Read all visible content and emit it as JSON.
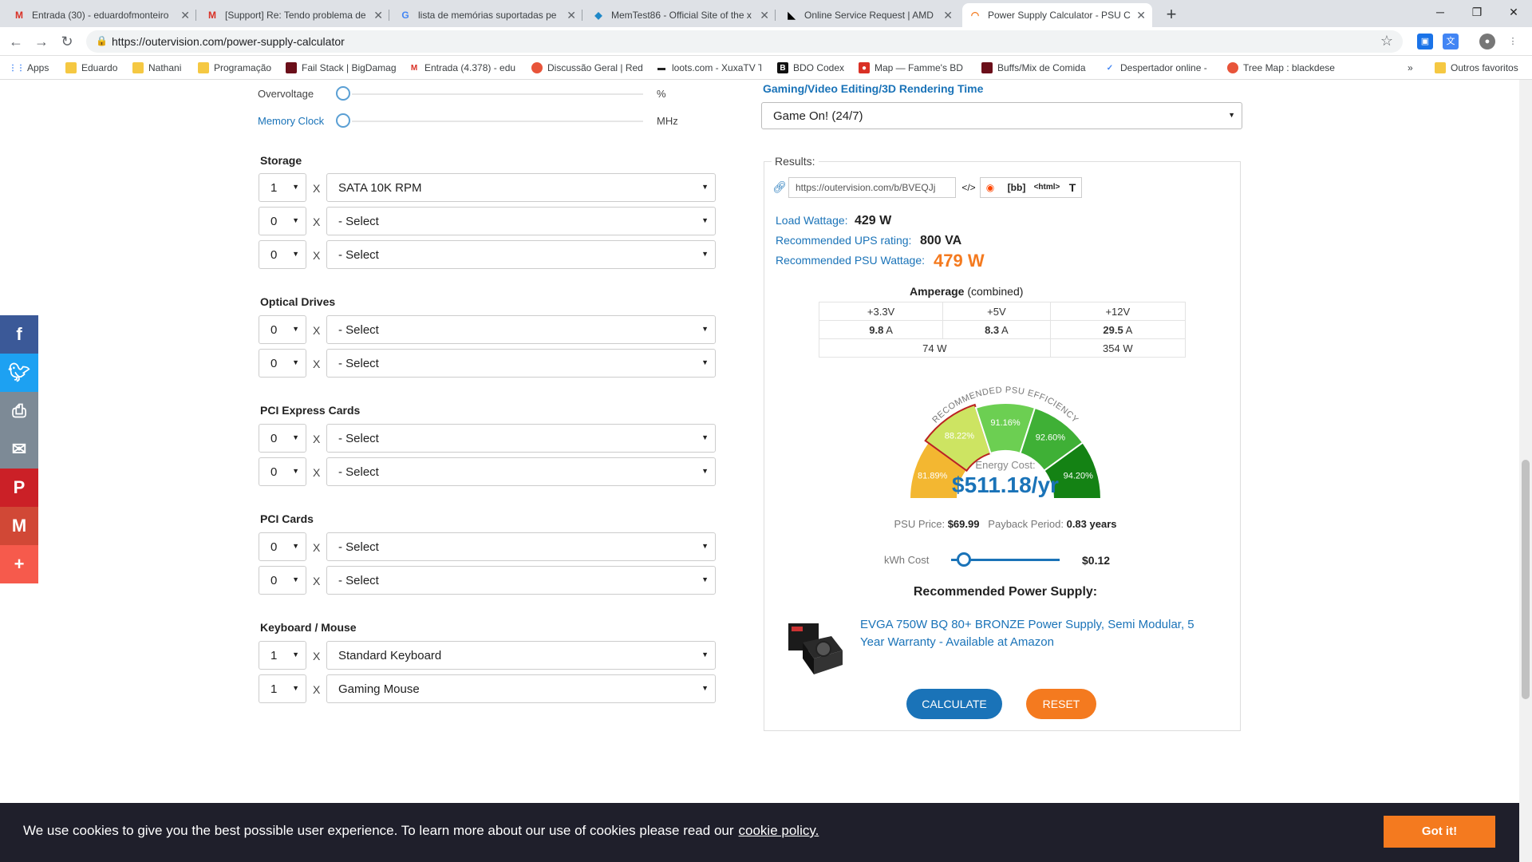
{
  "tabs": [
    {
      "title": "Entrada (30) - eduardofmonteiro",
      "icon": "gmail-icon"
    },
    {
      "title": "[Support] Re: Tendo problema de",
      "icon": "gmail-icon"
    },
    {
      "title": "lista de memórias suportadas pe",
      "icon": "google-icon"
    },
    {
      "title": "MemTest86 - Official Site of the x",
      "icon": "memtest-icon"
    },
    {
      "title": "Online Service Request | AMD",
      "icon": "amd-icon"
    },
    {
      "title": "Power Supply Calculator - PSU C",
      "icon": "outervision-icon"
    }
  ],
  "address": {
    "url": "https://outervision.com/power-supply-calculator"
  },
  "bookmarks": [
    {
      "label": "Apps"
    },
    {
      "label": "Eduardo"
    },
    {
      "label": "Nathani"
    },
    {
      "label": "Programação"
    },
    {
      "label": "Fail Stack | BigDamag"
    },
    {
      "label": "Entrada (4.378) - edu"
    },
    {
      "label": "Discussão Geral | Red"
    },
    {
      "label": "loots.com - XuxaTV T"
    },
    {
      "label": "BDO Codex"
    },
    {
      "label": "Map — Famme's BD"
    },
    {
      "label": "Buffs/Mix de Comida"
    },
    {
      "label": "Despertador online -"
    },
    {
      "label": "Tree Map : blackdese"
    },
    {
      "label": "»"
    },
    {
      "label": "Outros favoritos"
    }
  ],
  "overclock": {
    "overvoltage_label": "Overvoltage",
    "overvoltage_unit": "%",
    "memory_clock_label": "Memory Clock",
    "memory_clock_unit": "MHz"
  },
  "sections": {
    "storage": {
      "title": "Storage",
      "rows": [
        {
          "qty": "1",
          "value": "SATA 10K RPM"
        },
        {
          "qty": "0",
          "value": "- Select"
        },
        {
          "qty": "0",
          "value": "- Select"
        }
      ]
    },
    "optical": {
      "title": "Optical Drives",
      "rows": [
        {
          "qty": "0",
          "value": "- Select"
        },
        {
          "qty": "0",
          "value": "- Select"
        }
      ]
    },
    "pcie": {
      "title": "PCI Express Cards",
      "rows": [
        {
          "qty": "0",
          "value": "- Select"
        },
        {
          "qty": "0",
          "value": "- Select"
        }
      ]
    },
    "pci": {
      "title": "PCI Cards",
      "rows": [
        {
          "qty": "0",
          "value": "- Select"
        },
        {
          "qty": "0",
          "value": "- Select"
        }
      ]
    },
    "keyboard": {
      "title": "Keyboard / Mouse",
      "rows": [
        {
          "qty": "1",
          "value": "Standard Keyboard"
        },
        {
          "qty": "1",
          "value": "Gaming Mouse"
        }
      ]
    }
  },
  "x_sep": "X",
  "gaming_time": {
    "label": "Gaming/Video Editing/3D Rendering Time",
    "value": "Game On! (24/7)"
  },
  "results": {
    "legend": "Results:",
    "share_url": "https://outervision.com/b/BVEQJj",
    "share_buttons": [
      "</>",
      "[bb]",
      "<html>",
      "T"
    ],
    "load_wattage_label": "Load Wattage:",
    "load_wattage": "429 W",
    "ups_label": "Recommended UPS rating:",
    "ups": "800 VA",
    "psu_label": "Recommended PSU Wattage:",
    "psu": "479 W"
  },
  "amperage": {
    "title_bold": "Amperage",
    "title_rest": " (combined)",
    "rails": [
      "+3.3V",
      "+5V",
      "+12V"
    ],
    "amps": [
      "9.8",
      "8.3",
      "29.5"
    ],
    "amp_unit": "A",
    "watts": [
      "74 W",
      "354 W"
    ]
  },
  "efficiency": {
    "title": "RECOMMENDED PSU EFFICIENCY",
    "segments": [
      {
        "label": "81.89%",
        "color": "#f3b731"
      },
      {
        "label": "88.22%",
        "color": "#cde462"
      },
      {
        "label": "91.16%",
        "color": "#6ccf52"
      },
      {
        "label": "92.60%",
        "color": "#3fb036"
      },
      {
        "label": "94.20%",
        "color": "#148214"
      }
    ],
    "selected_index": 1,
    "energy_cost_label": "Energy Cost:",
    "energy_cost": "$511.18/yr"
  },
  "price": {
    "psu_price_label": "PSU Price:",
    "psu_price": "$69.99",
    "payback_label": "Payback Period:",
    "payback": "0.83 years"
  },
  "kwh": {
    "label": "kWh Cost",
    "value": "$0.12"
  },
  "recommendation": {
    "title": "Recommended Power Supply:",
    "product": "EVGA 750W BQ 80+ BRONZE Power Supply, Semi Modular, 5 Year Warranty - Available at Amazon"
  },
  "buttons": {
    "calculate": "CALCULATE",
    "reset": "RESET"
  },
  "social": [
    {
      "icon": "facebook-icon",
      "glyph": "f",
      "color": "#3b5998"
    },
    {
      "icon": "twitter-icon",
      "glyph": "t",
      "color": "#1da1f2"
    },
    {
      "icon": "print-icon",
      "glyph": "⎙",
      "color": "#7d8a96"
    },
    {
      "icon": "email-icon",
      "glyph": "✉",
      "color": "#7d8a96"
    },
    {
      "icon": "pinterest-icon",
      "glyph": "P",
      "color": "#cb2027"
    },
    {
      "icon": "gmail-icon",
      "glyph": "M",
      "color": "#d14836"
    },
    {
      "icon": "more-icon",
      "glyph": "+",
      "color": "#f65a4c"
    }
  ],
  "cookie": {
    "text": "We use cookies to give you the best possible user experience. To learn more about our use of cookies please read our",
    "link": "cookie policy.",
    "button": "Got it!"
  }
}
